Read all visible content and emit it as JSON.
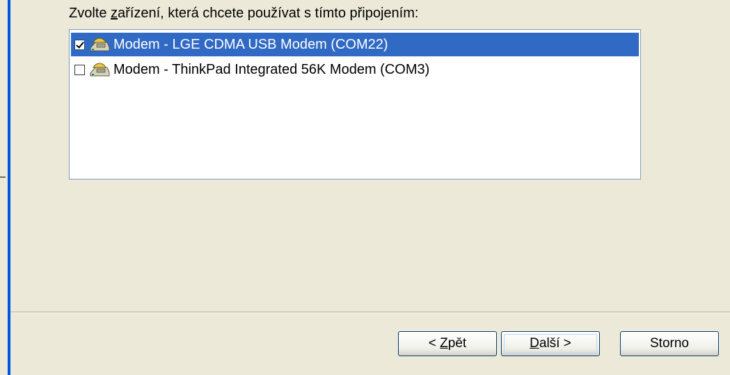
{
  "instruction": {
    "before": "Zvolte ",
    "underlined": "z",
    "after": "ařízení, která chcete používat s tímto připojením:"
  },
  "devices": [
    {
      "label": "Modem - LGE CDMA USB Modem (COM22)",
      "checked": true,
      "selected": true
    },
    {
      "label": "Modem - ThinkPad Integrated 56K Modem (COM3)",
      "checked": false,
      "selected": false
    }
  ],
  "buttons": {
    "back": {
      "before": "< ",
      "underlined": "Z",
      "after": "pět"
    },
    "next": {
      "underlined": "D",
      "after": "alší >"
    },
    "cancel": "Storno"
  },
  "colors": {
    "dialog_bg": "#ece9d8",
    "selection": "#316ac5",
    "frame_blue": "#0054e3"
  },
  "icons": {
    "device": "modem-icon",
    "check": "checkbox-checked"
  }
}
